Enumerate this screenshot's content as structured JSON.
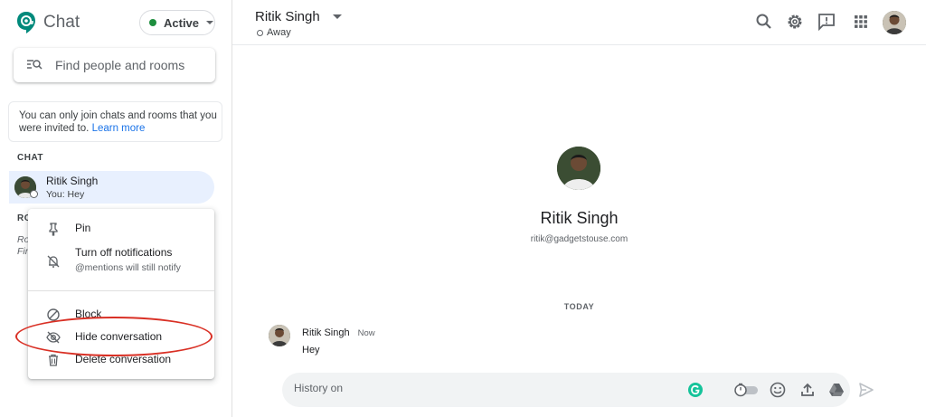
{
  "app": {
    "title": "Chat"
  },
  "status": {
    "label": "Active",
    "color": "#1e8e3e"
  },
  "search": {
    "placeholder": "Find people and rooms"
  },
  "info": {
    "text": "You can only join chats and rooms that you were invited to.",
    "link": "Learn more"
  },
  "sections": {
    "chat": "CHAT",
    "rooms_partial": "RO",
    "rooms_hint_1": "Ro",
    "rooms_hint_2": "Fir"
  },
  "chat_list": [
    {
      "name": "Ritik Singh",
      "preview": "You: Hey"
    }
  ],
  "context_menu": {
    "items": [
      {
        "label": "Pin",
        "icon": "pin-icon"
      },
      {
        "label": "Turn off notifications",
        "sub": "@mentions will still notify",
        "icon": "notifications-off-icon"
      },
      {
        "label": "Block",
        "icon": "block-icon"
      },
      {
        "label": "Hide conversation",
        "icon": "hide-icon"
      },
      {
        "label": "Delete conversation",
        "icon": "trash-icon"
      }
    ]
  },
  "header": {
    "name": "Ritik Singh",
    "status": "Away"
  },
  "profile": {
    "name": "Ritik Singh",
    "email": "ritik@gadgetstouse.com"
  },
  "conversation": {
    "day_label": "TODAY",
    "messages": [
      {
        "sender": "Ritik Singh",
        "time": "Now",
        "text": "Hey"
      }
    ]
  },
  "composer": {
    "placeholder": "History on"
  },
  "colors": {
    "accent": "#1a73e8",
    "brand_green": "#00897b",
    "highlight": "#d93025",
    "selected_bg": "#e8f0fe"
  }
}
